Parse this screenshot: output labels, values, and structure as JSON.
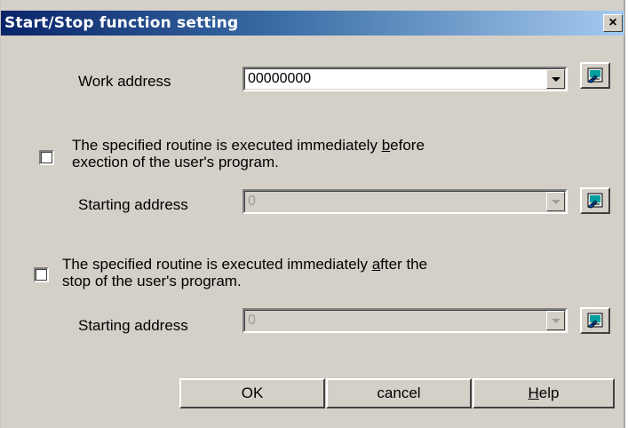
{
  "window": {
    "title": "Start/Stop function setting",
    "close_label": "×"
  },
  "work_address": {
    "label": "Work address",
    "value": "00000000"
  },
  "before_option": {
    "line1_pre": "The specified routine is executed immediately ",
    "line1_accel": "b",
    "line1_post": "efore",
    "line2": "exection of the user's program.",
    "checked": false,
    "starting_address_label": "Starting address",
    "starting_address_value": "0"
  },
  "after_option": {
    "line1_pre": "The specified routine is executed immediately ",
    "line1_accel": "a",
    "line1_post": "fter the",
    "line2": "stop of the user's program.",
    "checked": false,
    "starting_address_label": "Starting address",
    "starting_address_value": "0"
  },
  "buttons": {
    "ok": "OK",
    "cancel": "cancel",
    "help_accel": "H",
    "help_rest": "elp"
  },
  "icons": {
    "browse": "symbol-browse-icon"
  }
}
